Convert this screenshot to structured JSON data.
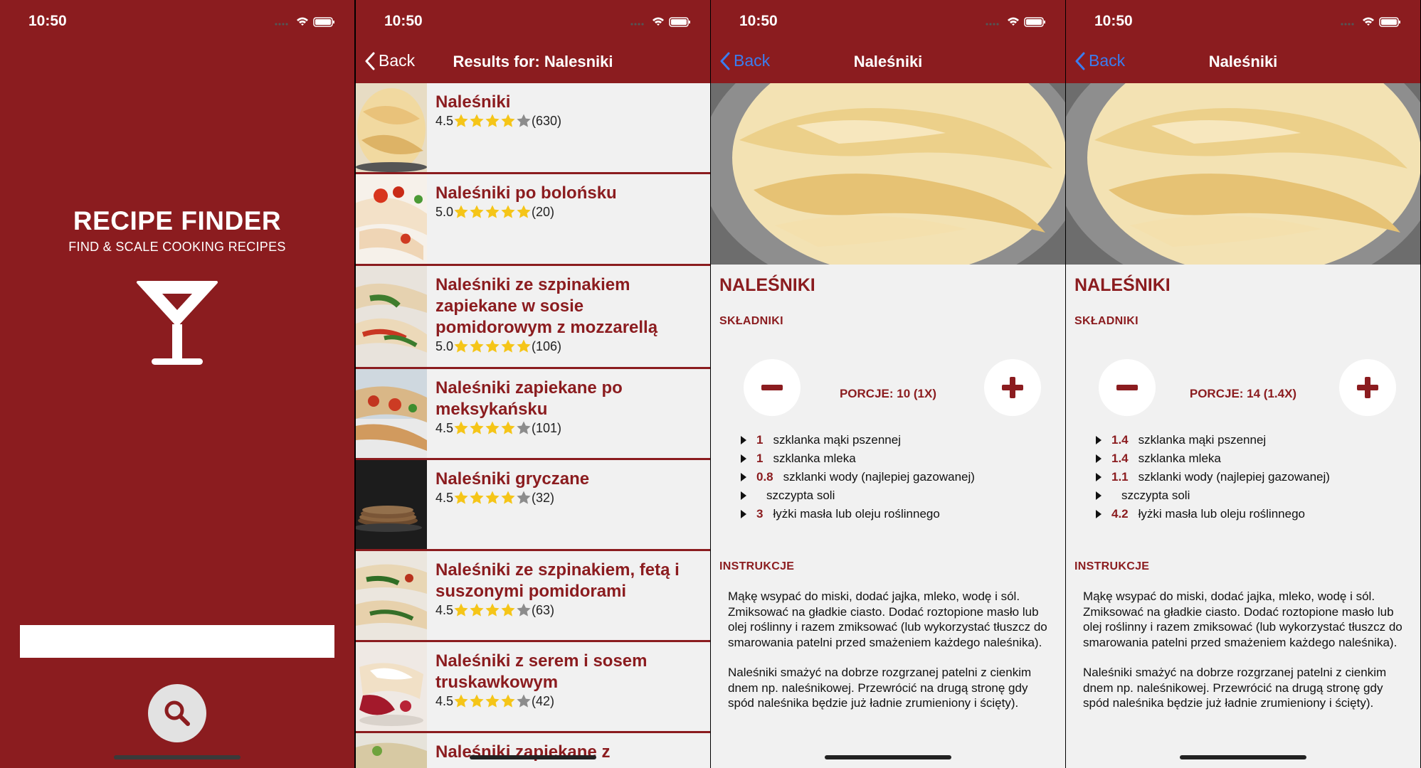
{
  "status": {
    "time": "10:50"
  },
  "home": {
    "title": "RECIPE FINDER",
    "subtitle": "FIND & SCALE COOKING RECIPES",
    "search_value": "",
    "search_icon": "magnifier-icon",
    "logo_icon": "cocktail-glass-icon"
  },
  "results": {
    "back_label": "Back",
    "title": "Results for: Nalesniki",
    "items": [
      {
        "name": "Naleśniki",
        "score": "4.5",
        "count": "(630)",
        "stars": 4.5
      },
      {
        "name": "Naleśniki po bolońsku",
        "score": "5.0",
        "count": "(20)",
        "stars": 5
      },
      {
        "name": "Naleśniki ze szpinakiem zapiekane w sosie pomidorowym z mozzarellą",
        "score": "5.0",
        "count": "(106)",
        "stars": 5
      },
      {
        "name": "Naleśniki zapiekane po meksykańsku",
        "score": "4.5",
        "count": "(101)",
        "stars": 4.5
      },
      {
        "name": "Naleśniki gryczane",
        "score": "4.5",
        "count": "(32)",
        "stars": 4.5
      },
      {
        "name": "Naleśniki ze szpinakiem, fetą i suszonymi pomidorami",
        "score": "4.5",
        "count": "(63)",
        "stars": 4.5
      },
      {
        "name": "Naleśniki z serem i sosem truskawkowym",
        "score": "4.5",
        "count": "(42)",
        "stars": 4.5
      },
      {
        "name": "Naleśniki zapiekane z",
        "score": "",
        "count": "",
        "stars": 0
      }
    ]
  },
  "detail1": {
    "back_label": "Back",
    "nav_title": "Naleśniki",
    "recipe_title": "NALEŚNIKI",
    "ingredients_heading": "SKŁADNIKI",
    "portions": "PORCJE: 10 (1X)",
    "ingredients": [
      {
        "qty": "1",
        "text": "szklanka mąki pszennej"
      },
      {
        "qty": "1",
        "text": "szklanka mleka"
      },
      {
        "qty": "0.8",
        "text": "szklanki wody (najlepiej gazowanej)"
      },
      {
        "qty": "",
        "text": "szczypta soli"
      },
      {
        "qty": "3",
        "text": "łyżki masła lub oleju roślinnego"
      }
    ],
    "instructions_heading": "INSTRUKCJE",
    "instructions": [
      "Mąkę wsypać do miski, dodać jajka, mleko, wodę i sól. Zmiksować na gładkie ciasto. Dodać roztopione masło lub olej roślinny i razem zmiksować (lub wykorzystać tłuszcz do smarowania patelni przed smażeniem każdego naleśnika).",
      "Naleśniki smażyć na dobrze rozgrzanej patelni z cienkim dnem np. naleśnikowej. Przewrócić na drugą stronę gdy spód naleśnika będzie już ładnie zrumieniony i ścięty)."
    ]
  },
  "detail2": {
    "back_label": "Back",
    "nav_title": "Naleśniki",
    "recipe_title": "NALEŚNIKI",
    "ingredients_heading": "SKŁADNIKI",
    "portions": "PORCJE: 14 (1.4X)",
    "ingredients": [
      {
        "qty": "1.4",
        "text": "szklanka mąki pszennej"
      },
      {
        "qty": "1.4",
        "text": "szklanka mleka"
      },
      {
        "qty": "1.1",
        "text": "szklanki wody (najlepiej gazowanej)"
      },
      {
        "qty": "",
        "text": "szczypta soli"
      },
      {
        "qty": "4.2",
        "text": "łyżki masła lub oleju roślinnego"
      }
    ],
    "instructions_heading": "INSTRUKCJE",
    "instructions": [
      "Mąkę wsypać do miski, dodać jajka, mleko, wodę i sól. Zmiksować na gładkie ciasto. Dodać roztopione masło lub olej roślinny i razem zmiksować (lub wykorzystać tłuszcz do smarowania patelni przed smażeniem każdego naleśnika).",
      "Naleśniki smażyć na dobrze rozgrzanej patelni z cienkim dnem np. naleśnikowej. Przewrócić na drugą stronę gdy spód naleśnika będzie już ładnie zrumieniony i ścięty)."
    ]
  },
  "colors": {
    "brand": "#8b1c1f",
    "background": "#f1f1f1",
    "star": "#f5c518",
    "star_empty": "#8c8c8c",
    "back_blue": "#3a7df0"
  }
}
